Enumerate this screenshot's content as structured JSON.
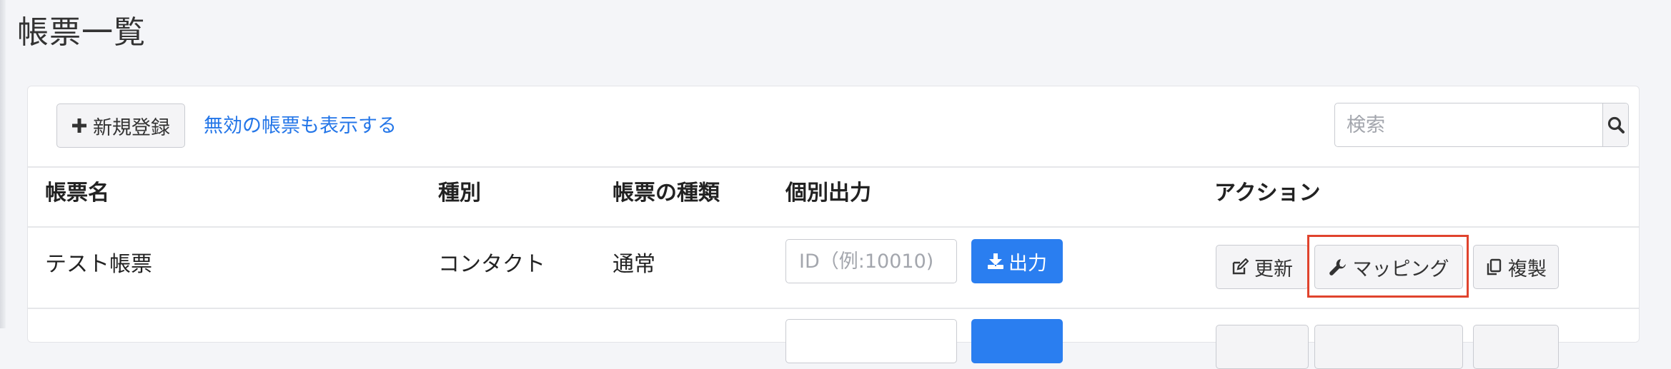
{
  "page": {
    "title": "帳票一覧"
  },
  "toolbar": {
    "new_label": "新規登録",
    "show_disabled_link": "無効の帳票も表示する",
    "search_placeholder": "検索"
  },
  "table": {
    "columns": [
      "帳票名",
      "種別",
      "帳票の種類",
      "個別出力",
      "アクション"
    ],
    "rows": [
      {
        "name": "テスト帳票",
        "kind": "コンタクト",
        "type": "通常",
        "id_placeholder": "ID（例:10010)",
        "output_label": "出力",
        "actions": {
          "update": "更新",
          "mapping": "マッピング",
          "duplicate": "複製"
        }
      }
    ]
  },
  "colors": {
    "primary": "#2a7ef0",
    "link": "#2476e8",
    "highlight": "#e0432d",
    "background": "#f4f5f8"
  },
  "icons": {
    "new": "plus-icon",
    "search": "search-icon",
    "output": "download-icon",
    "update": "edit-icon",
    "mapping": "wrench-icon",
    "duplicate": "copy-icon"
  }
}
